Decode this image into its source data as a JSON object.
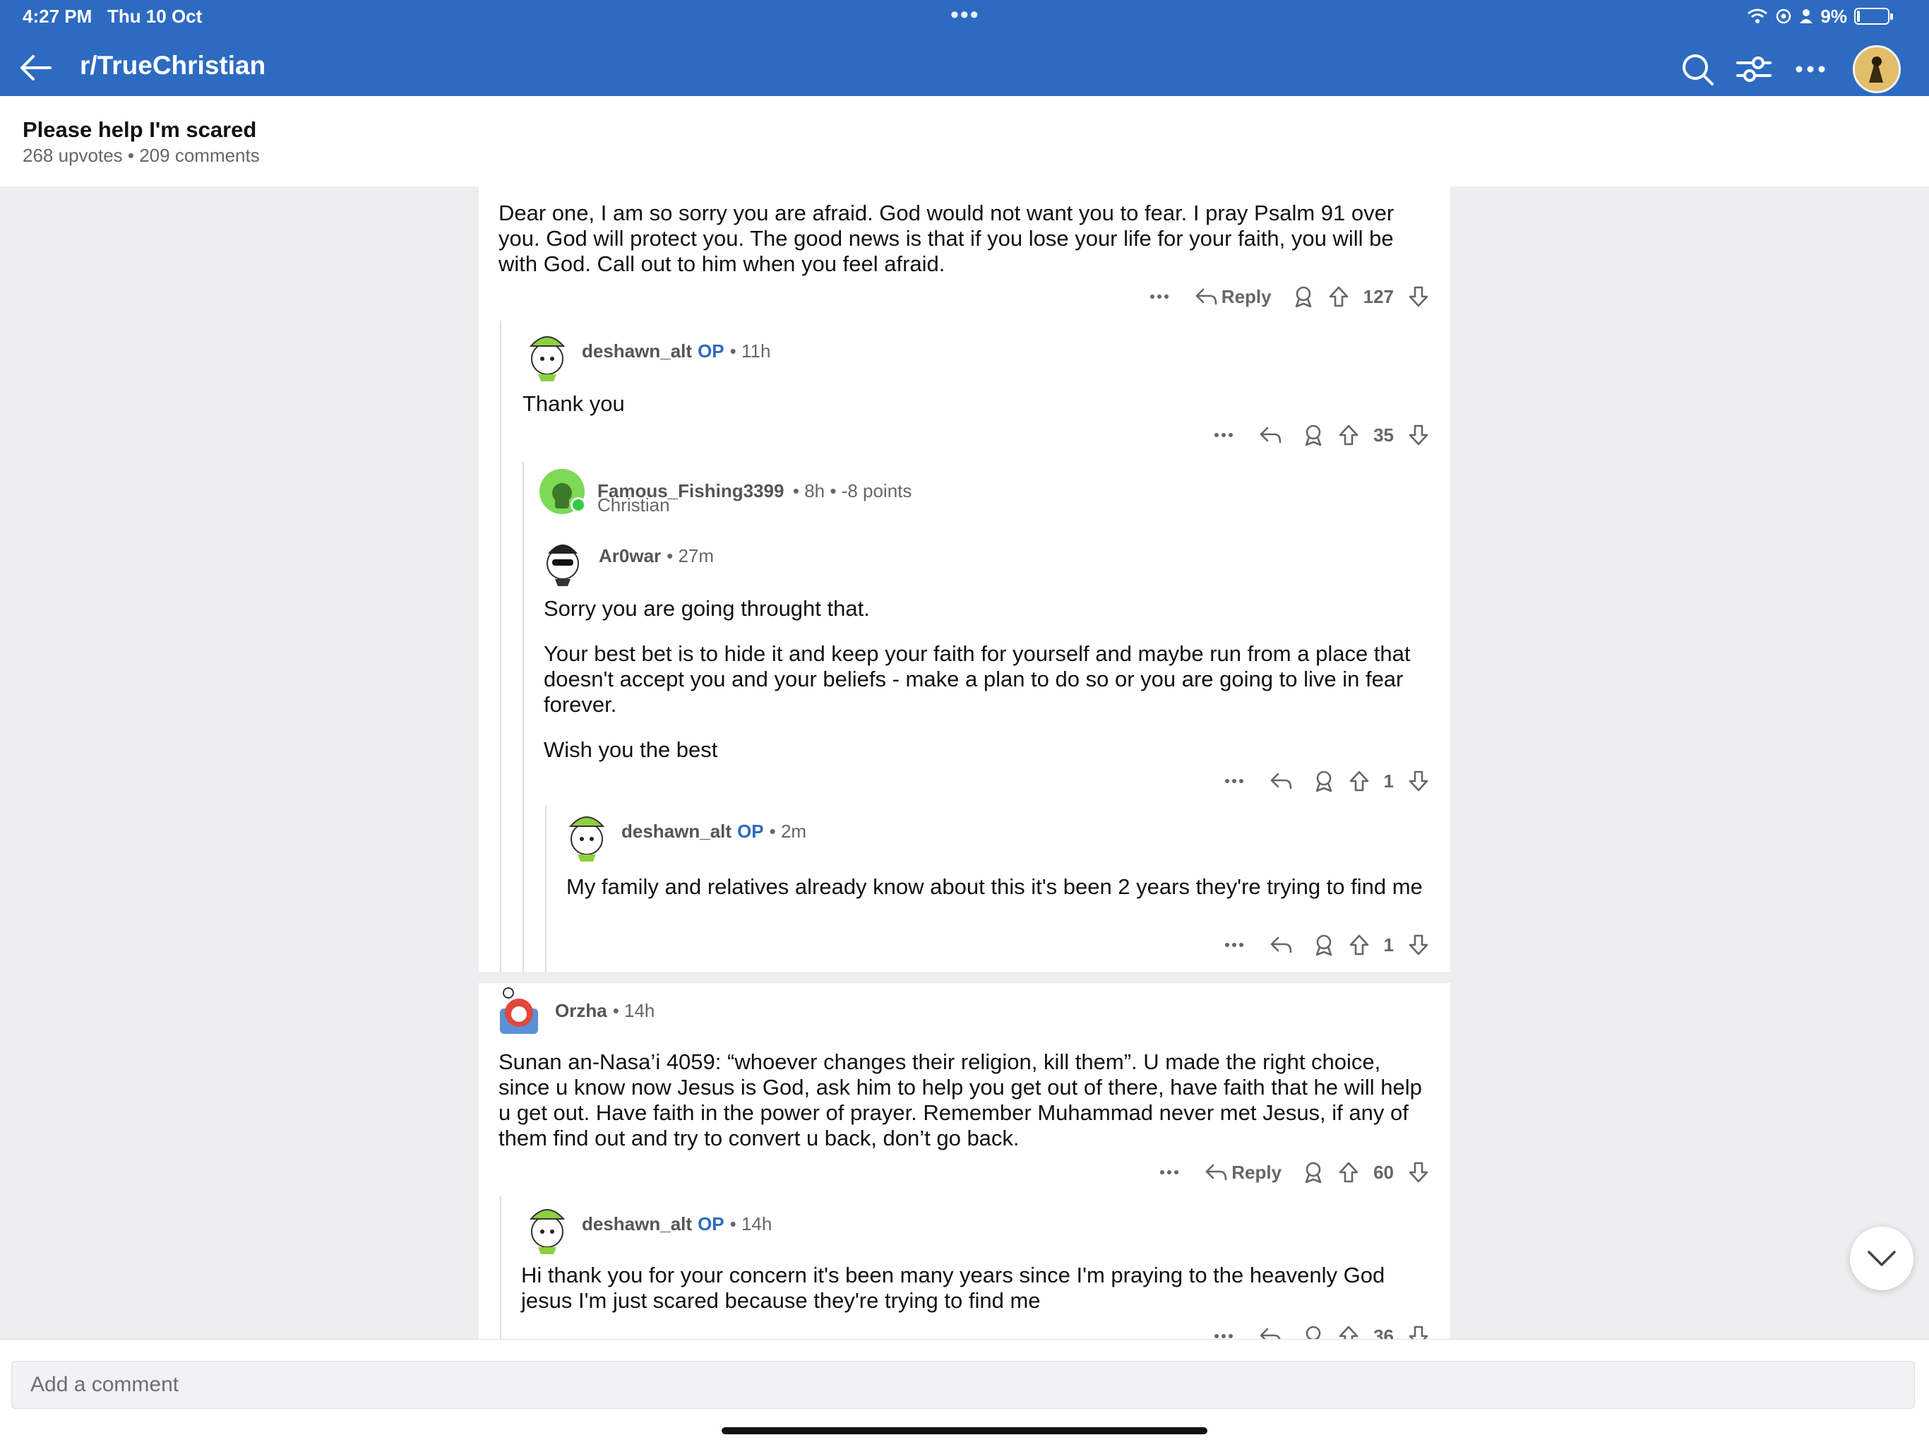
{
  "status_bar": {
    "time": "4:27 PM",
    "date": "Thu 10 Oct",
    "battery_text": "9%",
    "battery_level": 0.09,
    "multitask_dots": "•••"
  },
  "nav": {
    "subreddit": "r/TrueChristian",
    "icons": [
      "back-arrow-icon",
      "search-icon",
      "filter-icon",
      "more-icon",
      "user-avatar"
    ]
  },
  "post": {
    "title": "Please help I'm scared",
    "meta": "268 upvotes • 209 comments"
  },
  "comments": [
    {
      "body": [
        "Dear one, I am so sorry you are afraid. God would not want you to fear. I pray Psalm 91 over you. God will protect you. The good news is that if you lose your life for your faith, you will be with God. Call out to him when you feel afraid."
      ],
      "reply_label": "Reply",
      "score": "127"
    },
    {
      "user": "deshawn_alt",
      "op_badge": "OP",
      "meta": "• 11h",
      "body": [
        "Thank you"
      ],
      "score": "35"
    },
    {
      "user": "Famous_Fishing3399",
      "meta": "• 8h • -8 points",
      "flair": "Christian"
    },
    {
      "user": "Ar0war",
      "meta": "• 27m",
      "body": [
        "Sorry you are going throught that.",
        "Your best bet is to hide it and keep your faith for yourself and maybe run from a place that doesn't accept you and your beliefs - make a plan to do so or you are going to live in fear forever.",
        "Wish you the best"
      ],
      "score": "1"
    },
    {
      "user": "deshawn_alt",
      "op_badge": "OP",
      "meta": "• 2m",
      "body": [
        "My family and relatives already know about this it's been 2 years they're trying to find me"
      ],
      "score": "1"
    },
    {
      "user": "Orzha",
      "meta": "• 14h",
      "body": [
        "Sunan an-Nasa’i 4059: “whoever changes their religion, kill them”. U made the right choice, since u know now Jesus is God, ask him to help you get out of there, have faith that he will help u get out. Have faith in the power of prayer. Remember Muhammad never met Jesus, if any of them find out and try to convert u back, don’t go back."
      ],
      "reply_label": "Reply",
      "score": "60"
    },
    {
      "user": "deshawn_alt",
      "op_badge": "OP",
      "meta": "• 14h",
      "body": [
        "Hi thank you for your concern it's been many years since I'm praying to the heavenly God jesus I'm just scared because they're trying to find me"
      ],
      "score": "36"
    }
  ],
  "composer": {
    "placeholder": "Add a comment"
  },
  "colors": {
    "nav_blue": "#2d6bc1",
    "op_blue": "#2d6bc1",
    "page_bg": "#eeeef0"
  }
}
